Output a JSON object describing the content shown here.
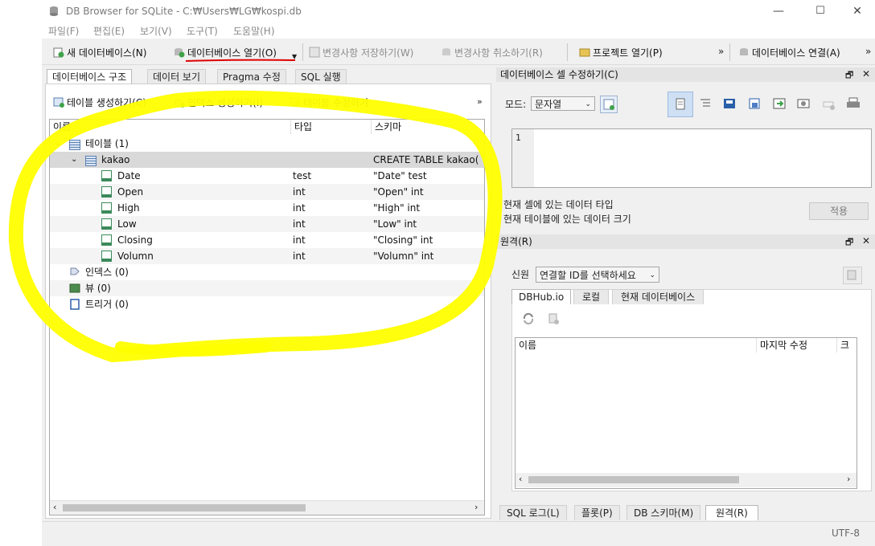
{
  "window": {
    "title": "DB Browser for SQLite - C:₩Users₩LG₩kospi.db",
    "minimize_glyph": "—",
    "maximize_glyph": "☐",
    "close_glyph": "✕"
  },
  "menu": [
    "파일(F)",
    "편집(E)",
    "보기(V)",
    "도구(T)",
    "도움말(H)"
  ],
  "toolbar": {
    "new_db": "새 데이터베이스(N)",
    "open_db": "데이터베이스 열기(O)",
    "write_changes": "변경사항 저장하기(W)",
    "revert_changes": "변경사항 취소하기(R)",
    "open_project": "프로젝트 열기(P)",
    "overflow": "»",
    "attach_db": "데이터베이스 연결(A)",
    "overflow2": "»"
  },
  "main_tabs": [
    "데이터베이스 구조",
    "데이터 보기",
    "Pragma 수정",
    "SQL 실행"
  ],
  "structure_toolbar": {
    "create_table": "테이블 생성하기(C)",
    "create_index": "인덱스 생성하기(I)",
    "modify_table": "테이블 수정하기",
    "overflow": "»"
  },
  "tree": {
    "columns": [
      "이름",
      "타입",
      "스키마"
    ],
    "tables_group": "테이블 (1)",
    "table": {
      "name": "kakao",
      "schema": "CREATE TABLE kakao("
    },
    "fields": [
      {
        "name": "Date",
        "type": "test",
        "schema": "\"Date\" test"
      },
      {
        "name": "Open",
        "type": "int",
        "schema": "\"Open\" int"
      },
      {
        "name": "High",
        "type": "int",
        "schema": "\"High\" int"
      },
      {
        "name": "Low",
        "type": "int",
        "schema": "\"Low\" int"
      },
      {
        "name": "Closing",
        "type": "int",
        "schema": "\"Closing\" int"
      },
      {
        "name": "Volumn",
        "type": "int",
        "schema": "\"Volumn\" int"
      }
    ],
    "indexes_group": "인덱스 (0)",
    "views_group": "뷰 (0)",
    "triggers_group": "트리거 (0)"
  },
  "edit_cell": {
    "title": "데이터베이스 셀 수정하기(C)",
    "mode_label": "모드:",
    "mode_value": "문자열",
    "line_number": "1",
    "type_info": "현재 셀에 있는 데이터 타입",
    "size_info": "현재 테이블에 있는 데이터 크기",
    "apply": "적용"
  },
  "remote": {
    "title": "원격(R)",
    "identity_label": "신원",
    "identity_value": "연결할 ID를 선택하세요",
    "tabs": [
      "DBHub.io",
      "로컬",
      "현재 데이터베이스"
    ],
    "columns": [
      "이름",
      "마지막 수정",
      "크기"
    ]
  },
  "bottom_tabs": [
    "SQL 로그(L)",
    "플롯(P)",
    "DB 스키마(M)",
    "원격(R)"
  ],
  "status": {
    "encoding": "UTF-8"
  },
  "panel_buttons": {
    "float": "🗗",
    "close": "✕"
  },
  "colors": {
    "highlight": "#ffff00",
    "underline": "#e00000",
    "selected_row": "#d9d9d9"
  }
}
